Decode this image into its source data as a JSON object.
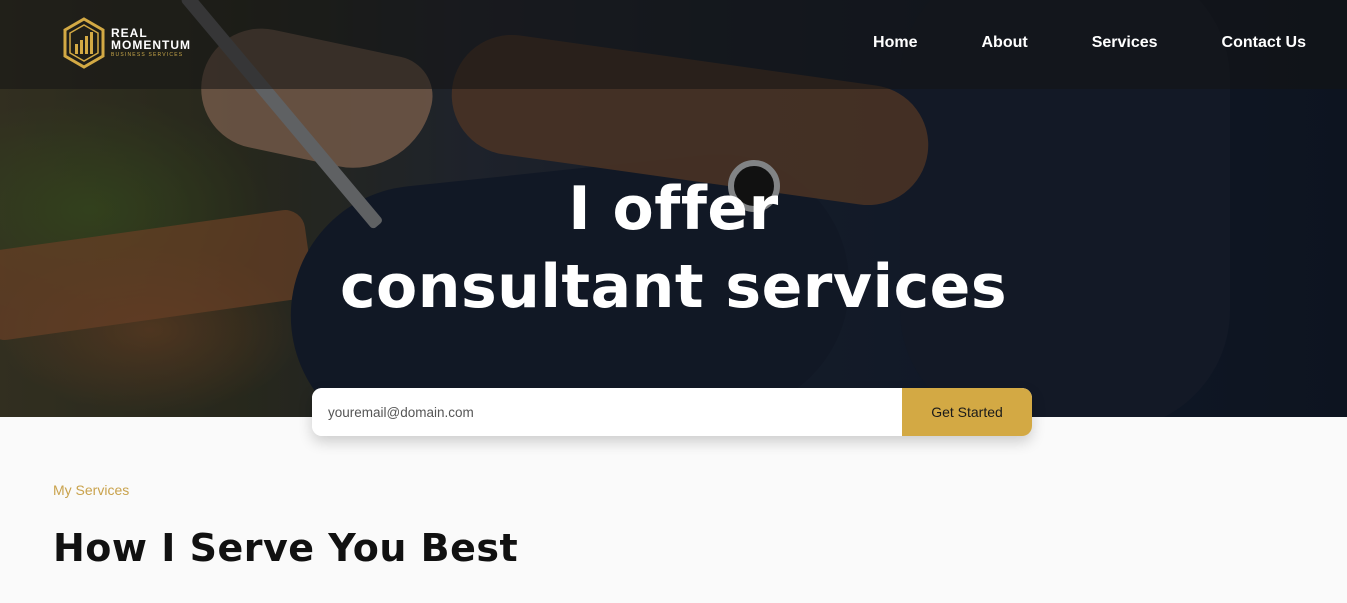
{
  "brand": {
    "name_line1": "REAL",
    "name_line2": "MOMENTUM",
    "tagline": "BUSINESS SERVICES",
    "accent_color": "#d3a944"
  },
  "nav": {
    "items": [
      {
        "label": "Home"
      },
      {
        "label": "About"
      },
      {
        "label": "Services"
      },
      {
        "label": "Contact Us"
      }
    ]
  },
  "hero": {
    "title_line1": "I offer",
    "title_line2": "consultant services",
    "email_placeholder": "youremail@domain.com",
    "cta_label": "Get Started"
  },
  "services": {
    "eyebrow": "My Services",
    "heading": "How I Serve You Best"
  }
}
